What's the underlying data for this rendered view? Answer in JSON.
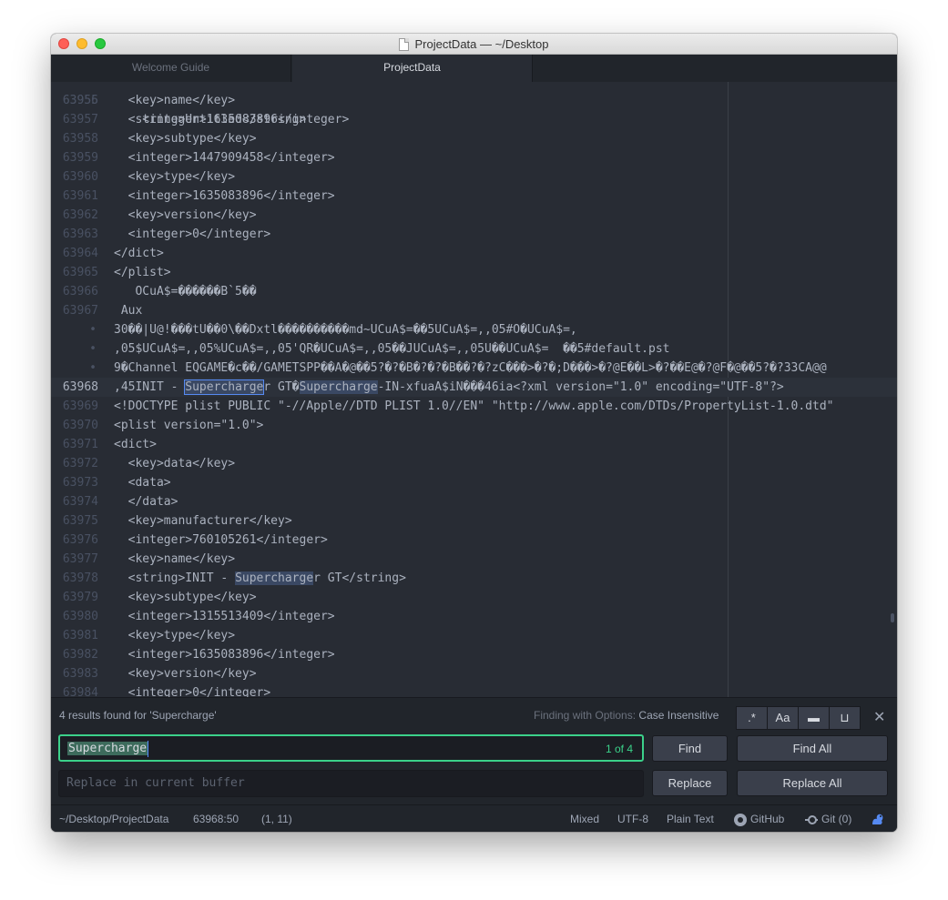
{
  "window": {
    "title": "ProjectData — ~/Desktop"
  },
  "tabs": [
    {
      "label": "Welcome Guide",
      "active": false
    },
    {
      "label": "ProjectData",
      "active": true
    }
  ],
  "editor": {
    "top_partial": "    <integer>1635083896</integer>",
    "lines": [
      {
        "num": "63956",
        "segs": [
          {
            "t": "  <key>name</key>"
          }
        ]
      },
      {
        "num": "63957",
        "segs": [
          {
            "t": "  <string>Untitled</string>"
          }
        ]
      },
      {
        "num": "63958",
        "segs": [
          {
            "t": "  <key>subtype</key>"
          }
        ]
      },
      {
        "num": "63959",
        "segs": [
          {
            "t": "  <integer>1447909458</integer>"
          }
        ]
      },
      {
        "num": "63960",
        "segs": [
          {
            "t": "  <key>type</key>"
          }
        ]
      },
      {
        "num": "63961",
        "segs": [
          {
            "t": "  <integer>1635083896</integer>"
          }
        ]
      },
      {
        "num": "63962",
        "segs": [
          {
            "t": "  <key>version</key>"
          }
        ]
      },
      {
        "num": "63963",
        "segs": [
          {
            "t": "  <integer>0</integer>"
          }
        ]
      },
      {
        "num": "63964",
        "segs": [
          {
            "t": "</dict>"
          }
        ]
      },
      {
        "num": "63965",
        "segs": [
          {
            "t": "</plist>"
          }
        ]
      },
      {
        "num": "63966",
        "segs": [
          {
            "t": "   OCuA$=������B`5��"
          }
        ]
      },
      {
        "num": "63967",
        "segs": [
          {
            "t": " Aux"
          }
        ]
      },
      {
        "num": "•",
        "segs": [
          {
            "t": "30��|U@!���tU��0\\��Dxtl����������md~UCuA$=��5UCuA$=,,05#O�UCuA$=,"
          }
        ]
      },
      {
        "num": "•",
        "segs": [
          {
            "t": ",05$UCuA$=,,05%UCuA$=,,05'QR�UCuA$=,,05��JUCuA$=,,05U��UCuA$=  ��5#default.pst"
          }
        ]
      },
      {
        "num": "•",
        "segs": [
          {
            "t": "9�Channel EQGAME�c��/GAMETSPP��A�@��5?�?�B�?�?�B��?�?zC���>�?�;D���>�?@E��L>�?��E@�?@F�@��5?�?33CA@@"
          }
        ]
      },
      {
        "num": "63968",
        "current": true,
        "segs": [
          {
            "t": ",45INIT - "
          },
          {
            "t": "Supercharge",
            "hl": "sel"
          },
          {
            "t": "r GT�"
          },
          {
            "t": "Supercharge",
            "hl": "match"
          },
          {
            "t": "-IN-xfuaA$iN���46ia<?xml version=\"1.0\" encoding=\"UTF-8\"?>"
          }
        ]
      },
      {
        "num": "63969",
        "segs": [
          {
            "t": "<!DOCTYPE plist PUBLIC \"-//Apple//DTD PLIST 1.0//EN\" \"http://www.apple.com/DTDs/PropertyList-1.0.dtd\""
          }
        ]
      },
      {
        "num": "63970",
        "segs": [
          {
            "t": "<plist version=\"1.0\">"
          }
        ]
      },
      {
        "num": "63971",
        "segs": [
          {
            "t": "<dict>"
          }
        ]
      },
      {
        "num": "63972",
        "segs": [
          {
            "t": "  <key>data</key>"
          }
        ]
      },
      {
        "num": "63973",
        "segs": [
          {
            "t": "  <data>"
          }
        ]
      },
      {
        "num": "63974",
        "segs": [
          {
            "t": "  </data>"
          }
        ]
      },
      {
        "num": "63975",
        "segs": [
          {
            "t": "  <key>manufacturer</key>"
          }
        ]
      },
      {
        "num": "63976",
        "segs": [
          {
            "t": "  <integer>760105261</integer>"
          }
        ]
      },
      {
        "num": "63977",
        "segs": [
          {
            "t": "  <key>name</key>"
          }
        ]
      },
      {
        "num": "63978",
        "segs": [
          {
            "t": "  <string>INIT - "
          },
          {
            "t": "Supercharge",
            "hl": "match"
          },
          {
            "t": "r GT</string>"
          }
        ]
      },
      {
        "num": "63979",
        "segs": [
          {
            "t": "  <key>subtype</key>"
          }
        ]
      },
      {
        "num": "63980",
        "segs": [
          {
            "t": "  <integer>1315513409</integer>"
          }
        ]
      },
      {
        "num": "63981",
        "segs": [
          {
            "t": "  <key>type</key>"
          }
        ]
      },
      {
        "num": "63982",
        "segs": [
          {
            "t": "  <integer>1635083896</integer>"
          }
        ]
      },
      {
        "num": "63983",
        "segs": [
          {
            "t": "  <key>version</key>"
          }
        ]
      },
      {
        "num": "63984",
        "segs": [
          {
            "t": "  <integer>0</integer>"
          }
        ]
      }
    ]
  },
  "find": {
    "results_text": "4 results found for 'Supercharge'",
    "options_prefix": "Finding with Options:",
    "options_value": "Case Insensitive",
    "option_buttons": [
      {
        "name": "regex-toggle",
        "glyph": ".*"
      },
      {
        "name": "case-sensitive-toggle",
        "glyph": "Aa"
      },
      {
        "name": "selection-only-toggle",
        "glyph": "▬"
      },
      {
        "name": "whole-word-toggle",
        "glyph": "⊔"
      }
    ],
    "close_glyph": "✕",
    "query": "Supercharge",
    "count": "1 of 4",
    "replace_placeholder": "Replace in current buffer",
    "find_label": "Find",
    "find_all_label": "Find All",
    "replace_label": "Replace",
    "replace_all_label": "Replace All"
  },
  "status": {
    "path": "~/Desktop/ProjectData",
    "cursor": "63968:50",
    "selection": "(1, 11)",
    "line_ending": "Mixed",
    "encoding": "UTF-8",
    "grammar": "Plain Text",
    "github": "GitHub",
    "git": "Git (0)"
  },
  "colors": {
    "accent_green": "#3bd18a",
    "match_highlight": "#3a4863",
    "selection_border": "#568af2"
  }
}
